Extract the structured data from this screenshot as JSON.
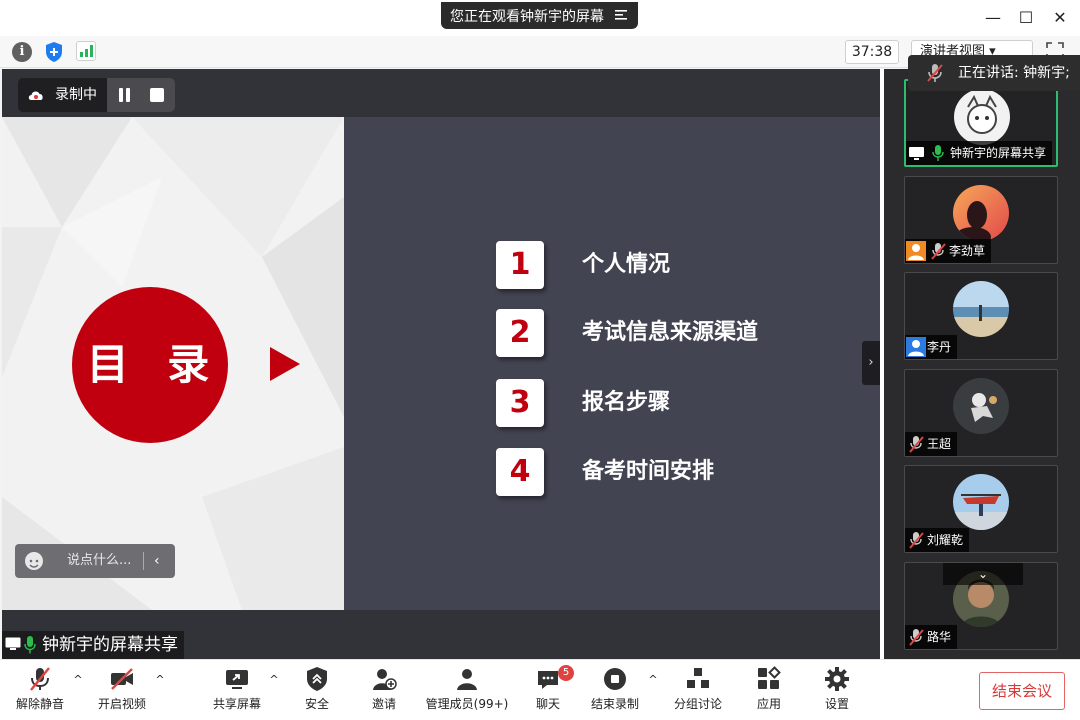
{
  "window": {
    "title": "您正在观看钟新宇的屏幕",
    "minimize": "—",
    "maximize": "☐",
    "close": "✕"
  },
  "toolbar": {
    "timer": "37:38",
    "presenter_view": "演讲者视图 ▾"
  },
  "speaking": {
    "text": "正在讲话: 钟新宇;"
  },
  "stage": {
    "recording_label": "录制中",
    "share_label": "钟新宇的屏幕共享",
    "chat_placeholder": "说点什么...",
    "chat_collapse": "‹",
    "sidebar_toggle": "›"
  },
  "slide": {
    "toc_title": "目 录",
    "items": [
      {
        "num": "1",
        "text": "个人情况"
      },
      {
        "num": "2",
        "text": "考试信息来源渠道"
      },
      {
        "num": "3",
        "text": "报名步骤"
      },
      {
        "num": "4",
        "text": "备考时间安排"
      }
    ]
  },
  "participants": [
    {
      "name": "钟新宇的屏幕共享",
      "muted": false,
      "active": true
    },
    {
      "name": "李劲草",
      "muted": true,
      "active": false
    },
    {
      "name": "李丹",
      "muted": null,
      "active": false
    },
    {
      "name": "王超",
      "muted": true,
      "active": false
    },
    {
      "name": "刘耀乾",
      "muted": true,
      "active": false
    },
    {
      "name": "路华",
      "muted": true,
      "active": false
    }
  ],
  "participants_collapse": "⌄",
  "bottombar": {
    "unmute": "解除静音",
    "start_video": "开启视频",
    "share_screen": "共享屏幕",
    "security": "安全",
    "invite": "邀请",
    "manage_members": "管理成员(99+)",
    "chat": "聊天",
    "chat_badge": "5",
    "end_recording": "结束录制",
    "breakout": "分组讨论",
    "apps": "应用",
    "settings": "设置",
    "end_meeting": "结束会议",
    "caret": "^"
  },
  "colors": {
    "accent_red": "#c0000e",
    "slide_dark": "#434452",
    "active_border": "#2dbd6e",
    "end_red": "#d93838"
  }
}
